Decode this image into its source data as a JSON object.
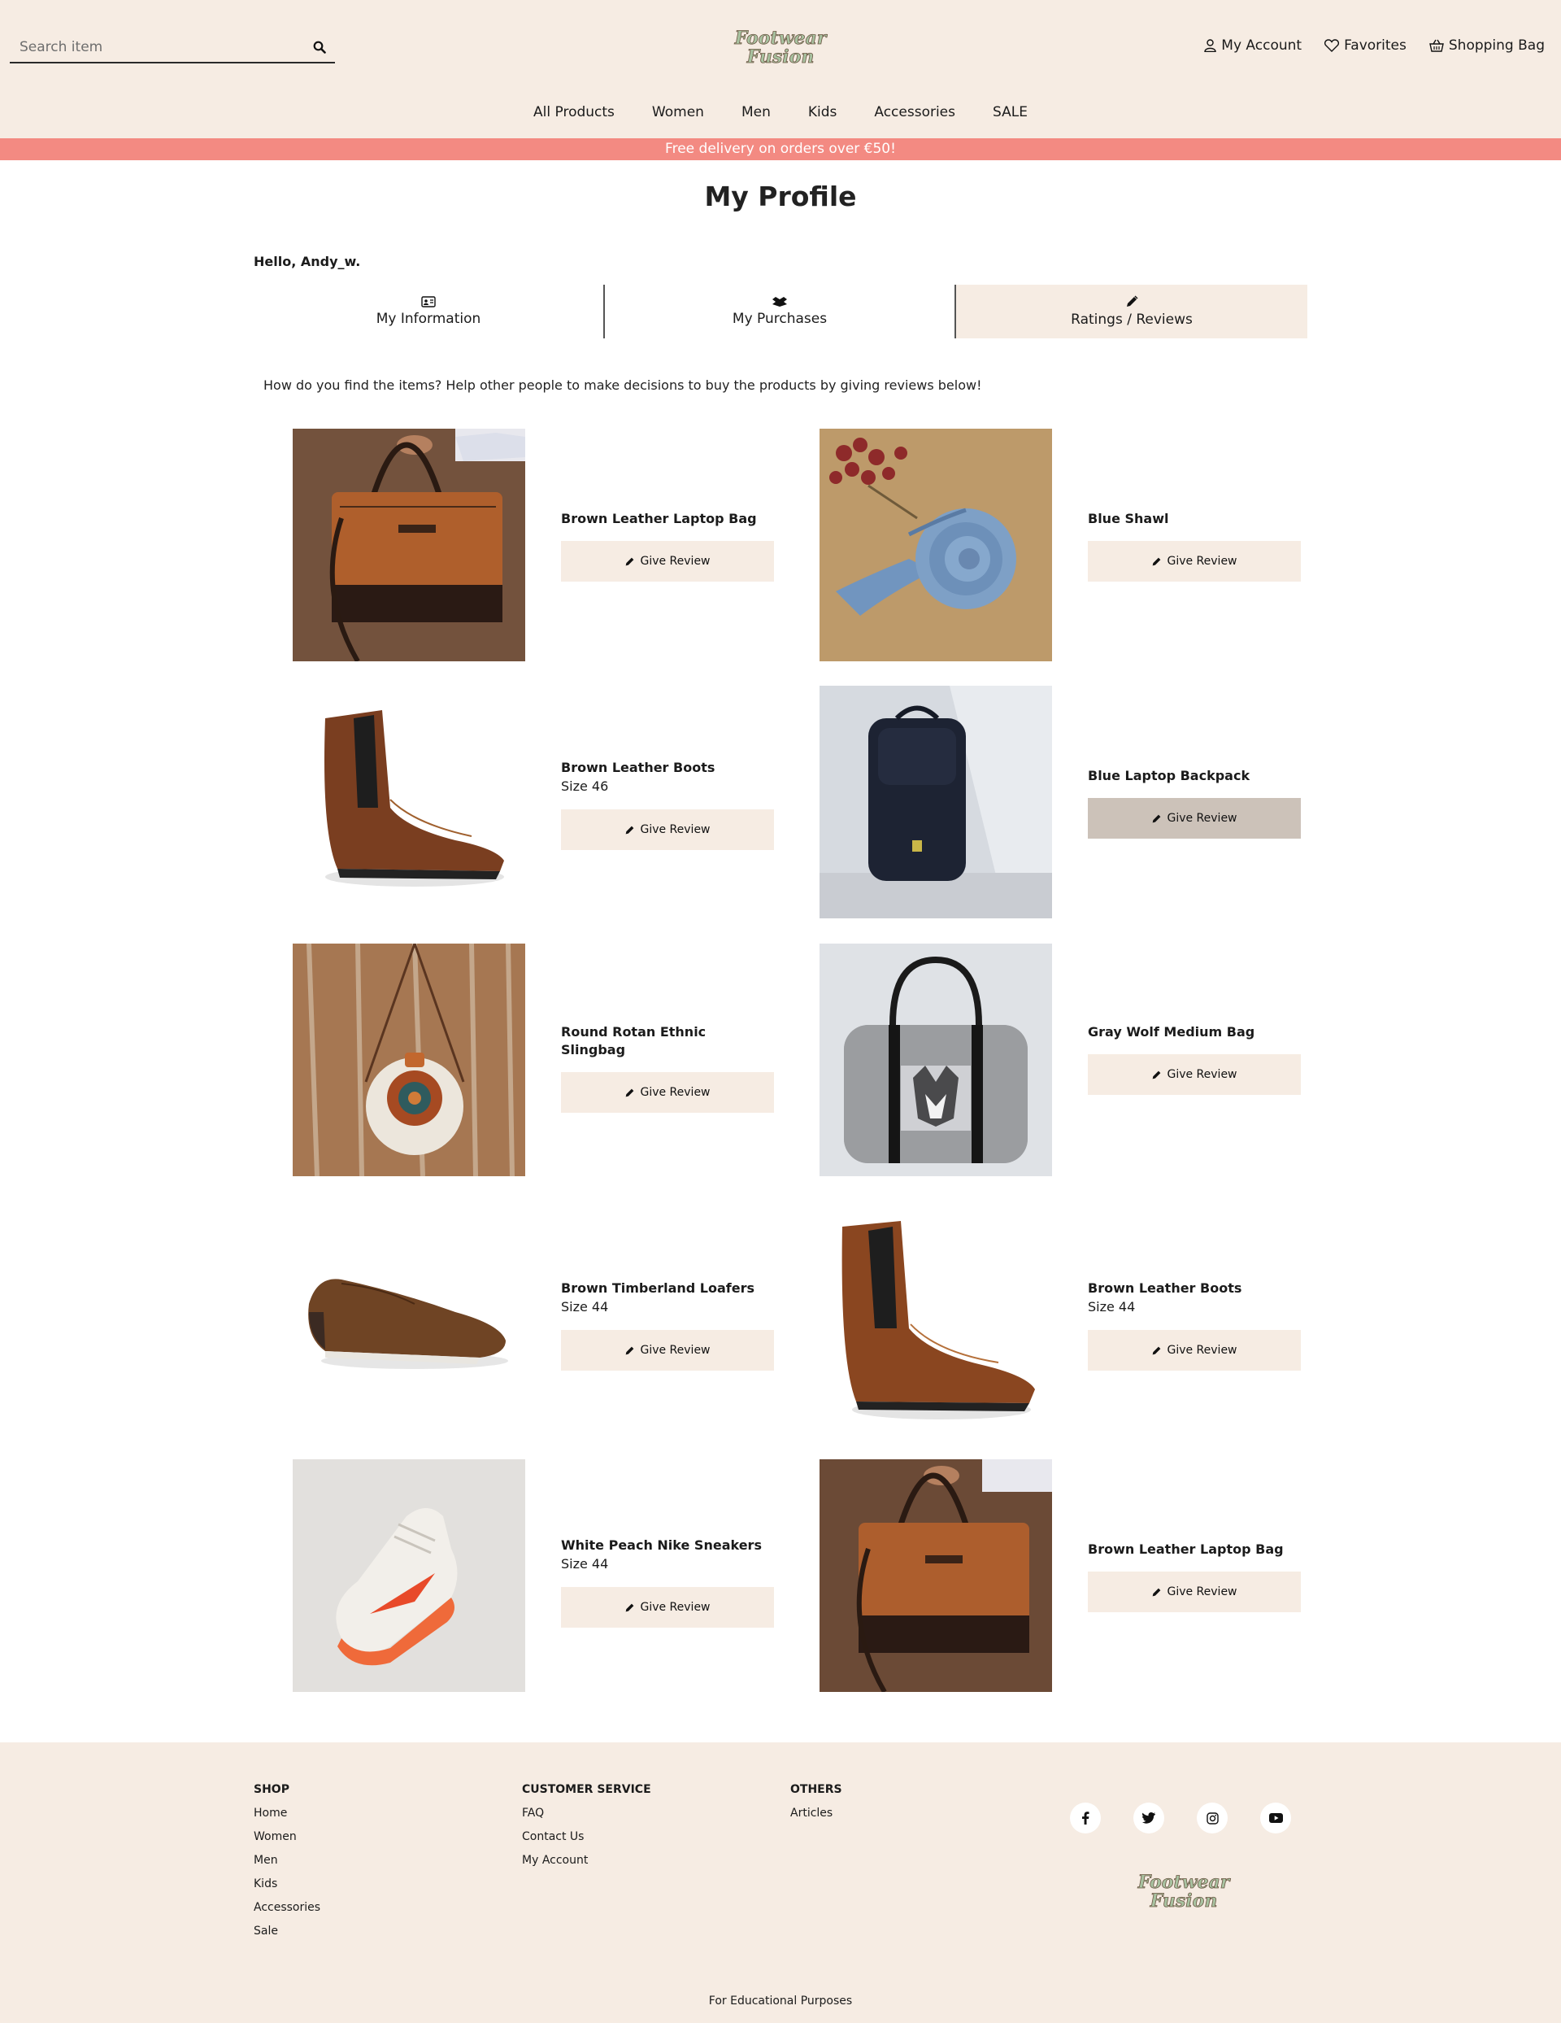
{
  "header": {
    "search_placeholder": "Search item",
    "logo_text_line1": "Footwear",
    "logo_text_line2": "Fusion",
    "account_label": "My Account",
    "favorites_label": "Favorites",
    "bag_label": "Shopping Bag"
  },
  "nav": [
    "All Products",
    "Women",
    "Men",
    "Kids",
    "Accessories",
    "SALE"
  ],
  "promo": "Free delivery on orders over €50!",
  "profile": {
    "title": "My Profile",
    "greeting": "Hello, Andy_w.",
    "tabs": [
      "My Information",
      "My Purchases",
      "Ratings / Reviews"
    ],
    "active_tab": "Ratings / Reviews",
    "intro": "How do you find the items? Help other people to make decisions to buy the products by giving reviews below!"
  },
  "review_button_label": "Give Review",
  "items": [
    {
      "name": "Brown Leather Laptop Bag",
      "size": ""
    },
    {
      "name": "Blue Shawl",
      "size": ""
    },
    {
      "name": "Brown Leather Boots",
      "size": "Size 46"
    },
    {
      "name": "Blue Laptop Backpack",
      "size": ""
    },
    {
      "name": "Round Rotan Ethnic Slingbag",
      "size": ""
    },
    {
      "name": "Gray Wolf Medium Bag",
      "size": ""
    },
    {
      "name": "Brown Timberland Loafers",
      "size": "Size 44"
    },
    {
      "name": "Brown Leather Boots",
      "size": "Size 44"
    },
    {
      "name": "White Peach Nike Sneakers",
      "size": "Size 44"
    },
    {
      "name": "Brown Leather Laptop Bag",
      "size": ""
    }
  ],
  "footer": {
    "shop": {
      "heading": "SHOP",
      "links": [
        "Home",
        "Women",
        "Men",
        "Kids",
        "Accessories",
        "Sale"
      ]
    },
    "service": {
      "heading": "CUSTOMER SERVICE",
      "links": [
        "FAQ",
        "Contact Us",
        "My Account"
      ]
    },
    "others": {
      "heading": "OTHERS",
      "links": [
        "Articles"
      ]
    },
    "socials": [
      "facebook-icon",
      "twitter-icon",
      "instagram-icon",
      "youtube-icon"
    ],
    "note": "For Educational Purposes"
  },
  "colors": {
    "header_bg": "#f6ece3",
    "promo_bg": "#f38a82",
    "button_bg": "#f6ece3",
    "button_hover_bg": "#ccc2b9"
  }
}
